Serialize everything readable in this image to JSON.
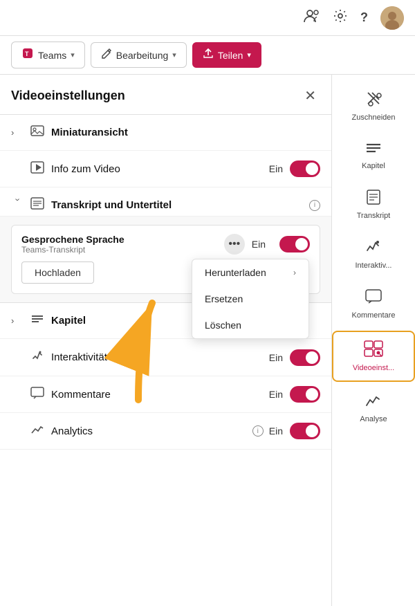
{
  "topbar": {
    "people_icon": "👥",
    "settings_icon": "⚙",
    "help_icon": "?"
  },
  "toolbar": {
    "teams_label": "Teams",
    "teams_icon": "🟥",
    "edit_label": "Bearbeitung",
    "edit_icon": "✏",
    "share_label": "Teilen",
    "share_icon": "⬆"
  },
  "panel": {
    "title": "Videoeinstellungen",
    "close_icon": "✕"
  },
  "settings": {
    "rows": [
      {
        "id": "miniatur",
        "expand": true,
        "icon": "🖼",
        "label": "Miniaturansicht",
        "has_toggle": false
      },
      {
        "id": "info",
        "expand": false,
        "icon": "▶",
        "label": "Info zum Video",
        "value": "Ein",
        "has_toggle": true
      },
      {
        "id": "transkript",
        "expand": true,
        "icon": "📄",
        "label": "Transkript und Untertitel",
        "info": true,
        "has_toggle": false
      }
    ],
    "transcript_card": {
      "title": "Gesprochene Sprache",
      "subtitle": "Teams-Transkript",
      "value": "Ein",
      "dots": "•••",
      "upload_label": "Hochladen"
    },
    "bottom_rows": [
      {
        "id": "kapitel",
        "expand": true,
        "icon": "≡",
        "label": "Kapitel",
        "has_toggle": false
      },
      {
        "id": "interaktiv",
        "expand": false,
        "icon": "⚡",
        "label": "Interaktivität",
        "value": "Ein",
        "has_toggle": true
      },
      {
        "id": "kommentare",
        "expand": false,
        "icon": "💬",
        "label": "Kommentare",
        "value": "Ein",
        "has_toggle": true
      },
      {
        "id": "analytics",
        "expand": false,
        "icon": "📈",
        "label": "Analytics",
        "info": true,
        "value": "Ein",
        "has_toggle": true
      }
    ]
  },
  "dropdown": {
    "items": [
      {
        "label": "Herunterladen",
        "has_arrow": true
      },
      {
        "label": "Ersetzen",
        "has_arrow": false
      },
      {
        "label": "Löschen",
        "has_arrow": false
      }
    ]
  },
  "right_nav": {
    "items": [
      {
        "id": "zuschneiden",
        "icon": "✂",
        "label": "Zuschneiden"
      },
      {
        "id": "kapitel",
        "icon": "☰",
        "label": "Kapitel"
      },
      {
        "id": "transkript",
        "icon": "📋",
        "label": "Transkript"
      },
      {
        "id": "interaktiv",
        "icon": "⚡",
        "label": "Interaktiv..."
      },
      {
        "id": "kommentare",
        "icon": "💬",
        "label": "Kommentare"
      },
      {
        "id": "videoeinst",
        "icon": "⊞",
        "label": "Videoeinst...",
        "active": true
      },
      {
        "id": "analyse",
        "icon": "📊",
        "label": "Analyse"
      }
    ]
  }
}
